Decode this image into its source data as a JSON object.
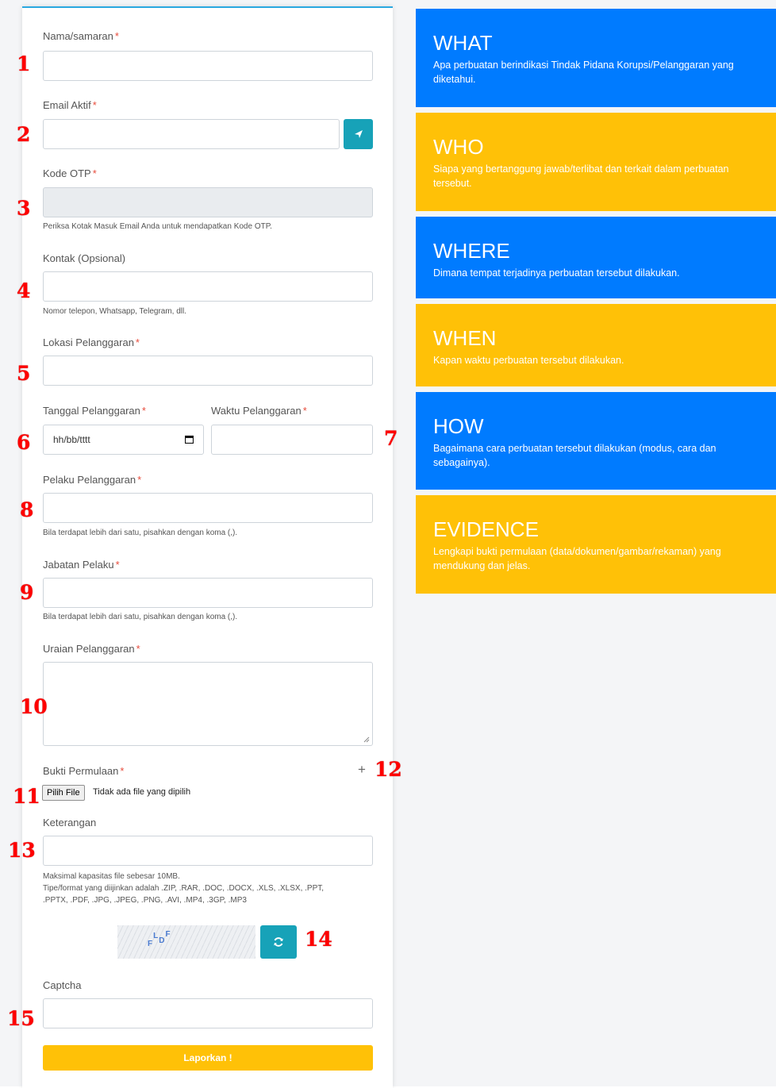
{
  "form": {
    "name": {
      "label": "Nama/samaran",
      "req": "*",
      "value": ""
    },
    "email": {
      "label": "Email Aktif",
      "req": "*",
      "value": ""
    },
    "otp": {
      "label": "Kode OTP",
      "req": "*",
      "help": "Periksa Kotak Masuk Email Anda untuk mendapatkan Kode OTP."
    },
    "contact": {
      "label": "Kontak (Opsional)",
      "help": "Nomor telepon, Whatsapp, Telegram, dll."
    },
    "location": {
      "label": "Lokasi Pelanggaran",
      "req": "*"
    },
    "date": {
      "label": "Tanggal Pelanggaran",
      "req": "*",
      "placeholder": "hh/bb/tttt"
    },
    "time": {
      "label": "Waktu Pelanggaran",
      "req": "*"
    },
    "perpetrator": {
      "label": "Pelaku Pelanggaran",
      "req": "*",
      "help": "Bila terdapat lebih dari satu, pisahkan dengan koma (,)."
    },
    "position": {
      "label": "Jabatan Pelaku",
      "req": "*",
      "help": "Bila terdapat lebih dari satu, pisahkan dengan koma (,)."
    },
    "description": {
      "label": "Uraian Pelanggaran",
      "req": "*"
    },
    "evidence": {
      "label": "Bukti Permulaan",
      "req": "*",
      "add_symbol": "+",
      "file_button": "Pilih File",
      "file_status": "Tidak ada file yang dipilih"
    },
    "note": {
      "label": "Keterangan",
      "help1": "Maksimal kapasitas file sebesar 10MB.",
      "help2": "Tipe/format yang diijinkan adalah .ZIP, .RAR, .DOC, .DOCX, .XLS, .XLSX, .PPT,",
      "help3": ".PPTX, .PDF, .JPG, .JPEG, .PNG, .AVI, .MP4, .3GP, .MP3"
    },
    "captcha": {
      "image_text": "FLDF",
      "label": "Captcha"
    },
    "submit": "Laporkan !"
  },
  "annotations": [
    "1",
    "2",
    "3",
    "4",
    "5",
    "6",
    "7",
    "8",
    "9",
    "10",
    "11",
    "12",
    "13",
    "14",
    "15"
  ],
  "info": [
    {
      "title": "WHAT",
      "desc": "Apa perbuatan berindikasi Tindak Pidana Korupsi/Pelanggaran yang diketahui.",
      "color": "#007bff"
    },
    {
      "title": "WHO",
      "desc": "Siapa yang bertanggung jawab/terlibat dan terkait dalam perbuatan tersebut.",
      "color": "#ffc107"
    },
    {
      "title": "WHERE",
      "desc": "Dimana tempat terjadinya perbuatan tersebut dilakukan.",
      "color": "#007bff"
    },
    {
      "title": "WHEN",
      "desc": "Kapan waktu perbuatan tersebut dilakukan.",
      "color": "#ffc107"
    },
    {
      "title": "HOW",
      "desc": "Bagaimana cara perbuatan tersebut dilakukan (modus, cara dan sebagainya).",
      "color": "#007bff"
    },
    {
      "title": "EVIDENCE",
      "desc": "Lengkapi bukti permulaan (data/dokumen/gambar/rekaman) yang mendukung dan jelas.",
      "color": "#ffc107"
    }
  ],
  "icons": {
    "send": "paper-plane-icon",
    "calendar": "calendar-icon",
    "refresh": "refresh-icon",
    "add": "plus-icon"
  }
}
